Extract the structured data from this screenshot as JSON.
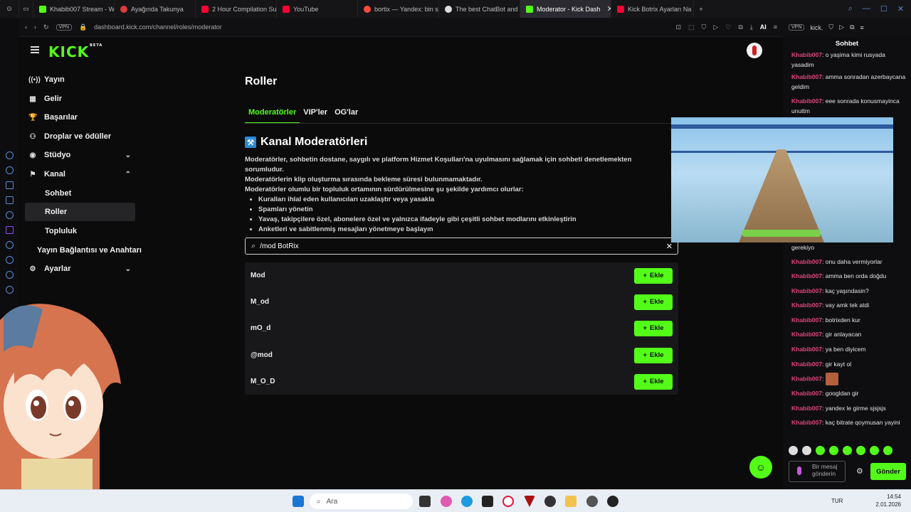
{
  "browser": {
    "tabs": [
      {
        "label": "Khabib007 Stream - W",
        "color": "#53fc18"
      },
      {
        "label": "Ayağında Takunya",
        "color": "#e03a3a"
      },
      {
        "label": "2 Hour Compilation Su",
        "color": "#ff0033"
      },
      {
        "label": "YouTube",
        "color": "#ff0033"
      },
      {
        "label": "bortix — Yandex: bin s",
        "color": "#ff4b3a"
      },
      {
        "label": "The best ChatBot and",
        "color": "#dddddd"
      },
      {
        "label": "Moderator - Kick Dash",
        "color": "#53fc18",
        "active": true
      },
      {
        "label": "Kick Botrix Ayarları Na",
        "color": "#ff0033"
      }
    ],
    "url": "dashboard.kick.com/channel/roles/moderator",
    "vpn_label": "VPN",
    "ai_label": "AI",
    "right_url": "kick."
  },
  "kick": {
    "logo": "KICK",
    "logo_badge": "BETA"
  },
  "nav": {
    "items": [
      {
        "label": "Yayın",
        "icon": "((•))"
      },
      {
        "label": "Gelir",
        "icon": "▦"
      },
      {
        "label": "Başarılar",
        "icon": "🏆"
      },
      {
        "label": "Droplar ve ödüller",
        "icon": "⚇"
      },
      {
        "label": "Stüdyo",
        "icon": "◉",
        "chevron": "⌄"
      },
      {
        "label": "Kanal",
        "icon": "⚑",
        "chevron": "⌃"
      },
      {
        "label": "Sohbet"
      },
      {
        "label": "Roller"
      },
      {
        "label": "Topluluk"
      },
      {
        "label": "Yayın Bağlantısı ve Anahtarı"
      },
      {
        "label": "Ayarlar",
        "icon": "⚙",
        "chevron": "⌄"
      }
    ]
  },
  "main": {
    "title": "Roller",
    "tabs": [
      "Moderatörler",
      "VIP'ler",
      "OG'lar"
    ],
    "section_title": "Kanal Moderatörleri",
    "desc_lines": [
      "Moderatörler, sohbetin dostane, saygılı ve platform Hizmet Koşulları'na uyulmasını sağlamak için sohbeti denetlemekten sorumludur.",
      "Moderatörlerin klip oluşturma sırasında bekleme süresi bulunmamaktadır.",
      "Moderatörler olumlu bir topluluk ortamının sürdürülmesine şu şekilde yardımcı olurlar:"
    ],
    "bullets": [
      "Kuralları ihlal eden kullanıcıları uzaklaştır veya yasakla",
      "Spamları yönetin",
      "Yavaş, takipçilere özel, abonelere özel ve yalnızca ifadeyle gibi çeşitli sohbet modlarını etkinleştirin",
      "Anketleri ve sabitlenmiş mesajları yönetmeye başlayın"
    ],
    "search_value": "/mod BotRix",
    "results": [
      {
        "name": "Mod",
        "button": "Ekle"
      },
      {
        "name": "M_od",
        "button": "Ekle"
      },
      {
        "name": "mO_d",
        "button": "Ekle"
      },
      {
        "name": "@mod",
        "button": "Ekle"
      },
      {
        "name": "M_O_D",
        "button": "Ekle"
      }
    ]
  },
  "chat": {
    "header": "Sohbet",
    "messages": [
      {
        "user": "Khabib007",
        "text": ": o yaşima kimi rusyada yasadim"
      },
      {
        "user": "Khabib007",
        "text": ": amma sonradan azerbaycana geldim"
      },
      {
        "user": "Khabib007",
        "text": ": eee sonrada konusmayinca unuttm"
      },
      {
        "user": "",
        "text": "gerekiyo"
      },
      {
        "user": "Khabib007",
        "text": ": onu daha vermiyorlar"
      },
      {
        "user": "Khabib007",
        "text": ": amma ben orda doğdu"
      },
      {
        "user": "Khabib007",
        "text": ": kaç yaşındasin?"
      },
      {
        "user": "Khabib007",
        "text": ": vay amk tek atdi"
      },
      {
        "user": "Khabib007",
        "text": ": botrixden kur"
      },
      {
        "user": "Khabib007",
        "text": ": gir anlayacan"
      },
      {
        "user": "Khabib007",
        "text": ": ya ben diyicem"
      },
      {
        "user": "Khabib007",
        "text": ": gir kayt ol"
      },
      {
        "user": "Khabib007",
        "text": ":",
        "emote": true
      },
      {
        "user": "Khabib007",
        "text": ": googldan gir"
      },
      {
        "user": "Khabib007",
        "text": ": yandex le girme sjsjsjs"
      },
      {
        "user": "Khabib007",
        "text": ": kaç bitrate qoymusan yayini"
      }
    ],
    "input_placeholder": "Bir mesaj gönderin",
    "send_label": "Gönder"
  },
  "taskbar": {
    "search_placeholder": "Ara",
    "lang": "TUR",
    "time": "14:54",
    "date": "2.01.2026"
  }
}
